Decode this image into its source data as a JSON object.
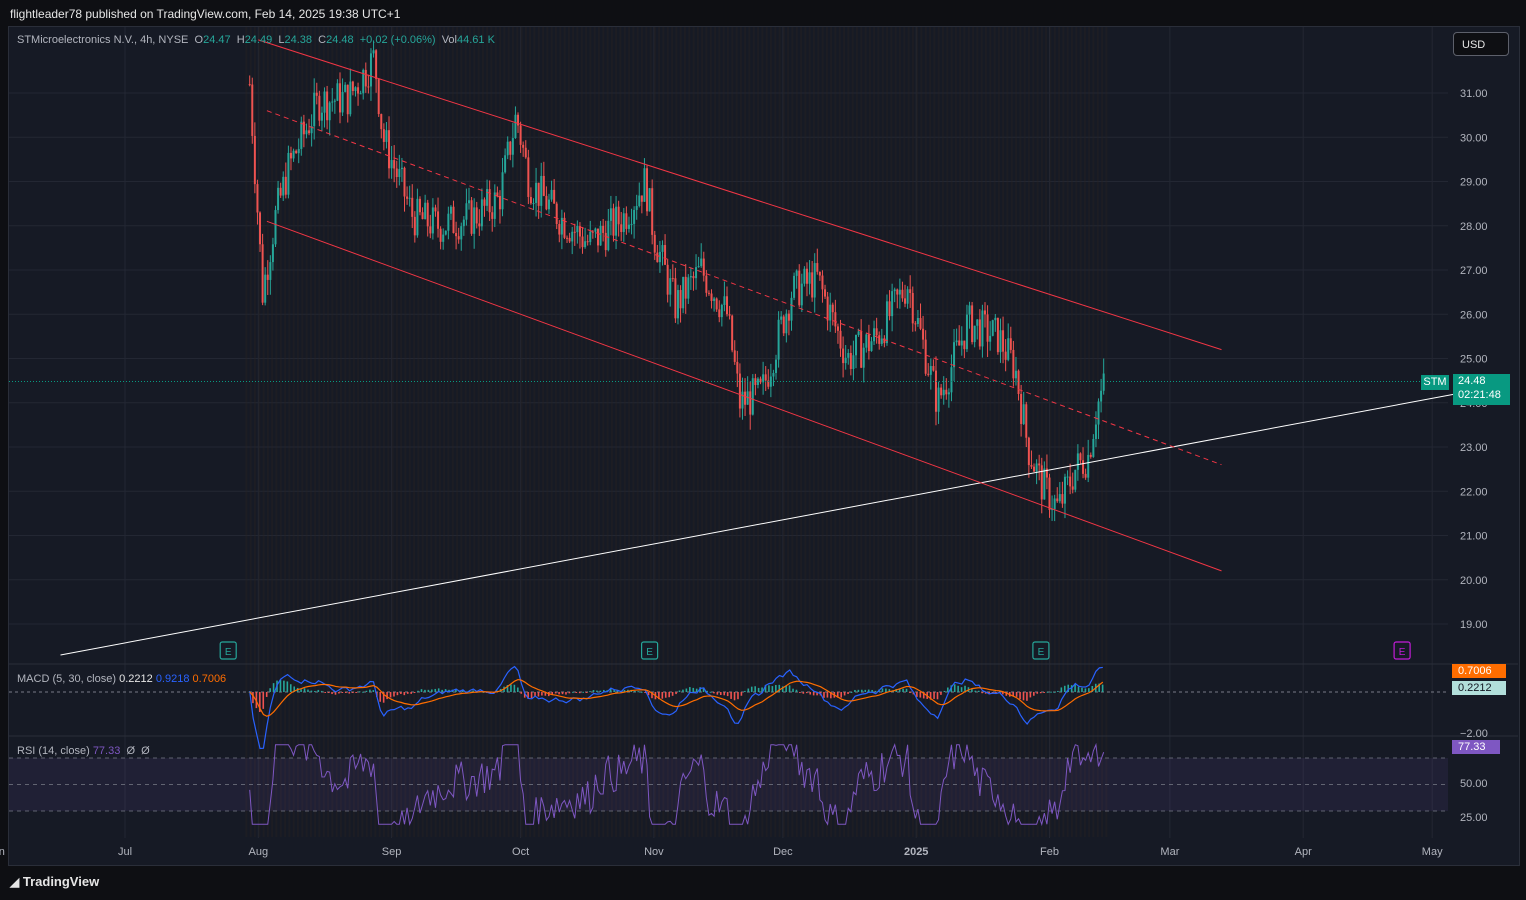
{
  "header": {
    "published": "flightleader78 published on TradingView.com, Feb 14, 2025 19:38 UTC+1"
  },
  "legend": {
    "symbol": "STMicroelectronics N.V., 4h, NYSE",
    "o_label": "O",
    "o": "24.47",
    "h_label": "H",
    "h": "24.49",
    "l_label": "L",
    "l": "24.38",
    "c_label": "C",
    "c": "24.48",
    "chg": "+0.02 (+0.06%)",
    "vol_label": "Vol",
    "vol": "44.61 K"
  },
  "currency": "USD",
  "price_tag": {
    "ticker": "STM",
    "price": "24.48",
    "countdown": "02:21:48"
  },
  "macd": {
    "label": "MACD (5, 30, close)",
    "v1": "0.2212",
    "v2": "0.9218",
    "v3": "0.7006",
    "tag_signal": "0.7006",
    "tag_macd": "0.2212",
    "axis_label": "−2.00"
  },
  "rsi": {
    "label": "RSI (14, close)",
    "v1": "77.33",
    "v2": "Ø",
    "v3": "Ø",
    "tag": "77.33",
    "axis": [
      "50.00",
      "25.00"
    ]
  },
  "brand": "TradingView",
  "colors": {
    "up": "#26a69a",
    "down": "#ef5350",
    "channel": "#f23645",
    "trend": "#ffffff",
    "macd": "#2962ff",
    "signal": "#ff6d00",
    "rsi": "#7e57c2",
    "bg": "#161a25"
  },
  "chart_data": {
    "type": "candlestick",
    "title": "STMicroelectronics N.V., 4h, NYSE",
    "y_axis_labels": [
      "31.00",
      "30.00",
      "29.00",
      "28.00",
      "27.00",
      "26.00",
      "25.00",
      "24.00",
      "23.00",
      "22.00",
      "21.00",
      "20.00",
      "19.00"
    ],
    "x_axis_labels": [
      "Jun",
      "Jul",
      "Aug",
      "Sep",
      "Oct",
      "Nov",
      "Dec",
      "2025",
      "Feb",
      "Mar",
      "Apr",
      "May"
    ],
    "ylim": [
      18.1,
      32.2
    ],
    "last_price": 24.48,
    "earnings_markers": [
      {
        "date": "Jul 25",
        "label": "E"
      },
      {
        "date": "Oct 31",
        "label": "E"
      },
      {
        "date": "Jan 30",
        "label": "E"
      },
      {
        "date": "Apr 24",
        "label": "E"
      }
    ],
    "price_path": [
      [
        "Jul 30",
        31.2
      ],
      [
        "Aug 2",
        26.5
      ],
      [
        "Aug 5",
        28.2
      ],
      [
        "Aug 8",
        29.3
      ],
      [
        "Aug 15",
        30.8
      ],
      [
        "Aug 22",
        30.9
      ],
      [
        "Aug 28",
        31.8
      ],
      [
        "Aug 30",
        30.0
      ],
      [
        "Sep 6",
        28.2
      ],
      [
        "Sep 12",
        28.0
      ],
      [
        "Sep 20",
        28.2
      ],
      [
        "Sep 26",
        28.6
      ],
      [
        "Sep 30",
        30.5
      ],
      [
        "Oct 3",
        29.0
      ],
      [
        "Oct 10",
        28.2
      ],
      [
        "Oct 17",
        27.6
      ],
      [
        "Oct 25",
        28.2
      ],
      [
        "Oct 30",
        29.0
      ],
      [
        "Nov 1",
        27.8
      ],
      [
        "Nov 6",
        26.2
      ],
      [
        "Nov 12",
        27.0
      ],
      [
        "Nov 18",
        26.0
      ],
      [
        "Nov 21",
        24.0
      ],
      [
        "Nov 26",
        24.2
      ],
      [
        "Dec 3",
        26.5
      ],
      [
        "Dec 9",
        26.8
      ],
      [
        "Dec 16",
        25.0
      ],
      [
        "Dec 23",
        25.5
      ],
      [
        "Dec 30",
        26.7
      ],
      [
        "Jan 6",
        24.0
      ],
      [
        "Jan 13",
        25.8
      ],
      [
        "Jan 20",
        25.5
      ],
      [
        "Jan 24",
        24.8
      ],
      [
        "Jan 27",
        23.0
      ],
      [
        "Jan 30",
        22.2
      ],
      [
        "Feb 3",
        21.6
      ],
      [
        "Feb 7",
        22.5
      ],
      [
        "Feb 10",
        22.8
      ],
      [
        "Feb 12",
        23.9
      ],
      [
        "Feb 14",
        24.48
      ]
    ],
    "drawings": [
      {
        "type": "trend_line",
        "from": [
          "Jun 16",
          18.3
        ],
        "to": [
          "May 12",
          24.3
        ]
      },
      {
        "type": "channel_upper",
        "from": [
          "Aug 1",
          32.2
        ],
        "to": [
          "Mar 13",
          25.2
        ]
      },
      {
        "type": "channel_mid",
        "from": [
          "Aug 3",
          30.6
        ],
        "to": [
          "Mar 13",
          22.6
        ]
      },
      {
        "type": "channel_lower",
        "from": [
          "Aug 3",
          28.1
        ],
        "to": [
          "Mar 13",
          20.2
        ]
      }
    ],
    "rsi_last": 77.33,
    "macd_last": {
      "macd": 0.2212,
      "signal": 0.7006
    }
  }
}
